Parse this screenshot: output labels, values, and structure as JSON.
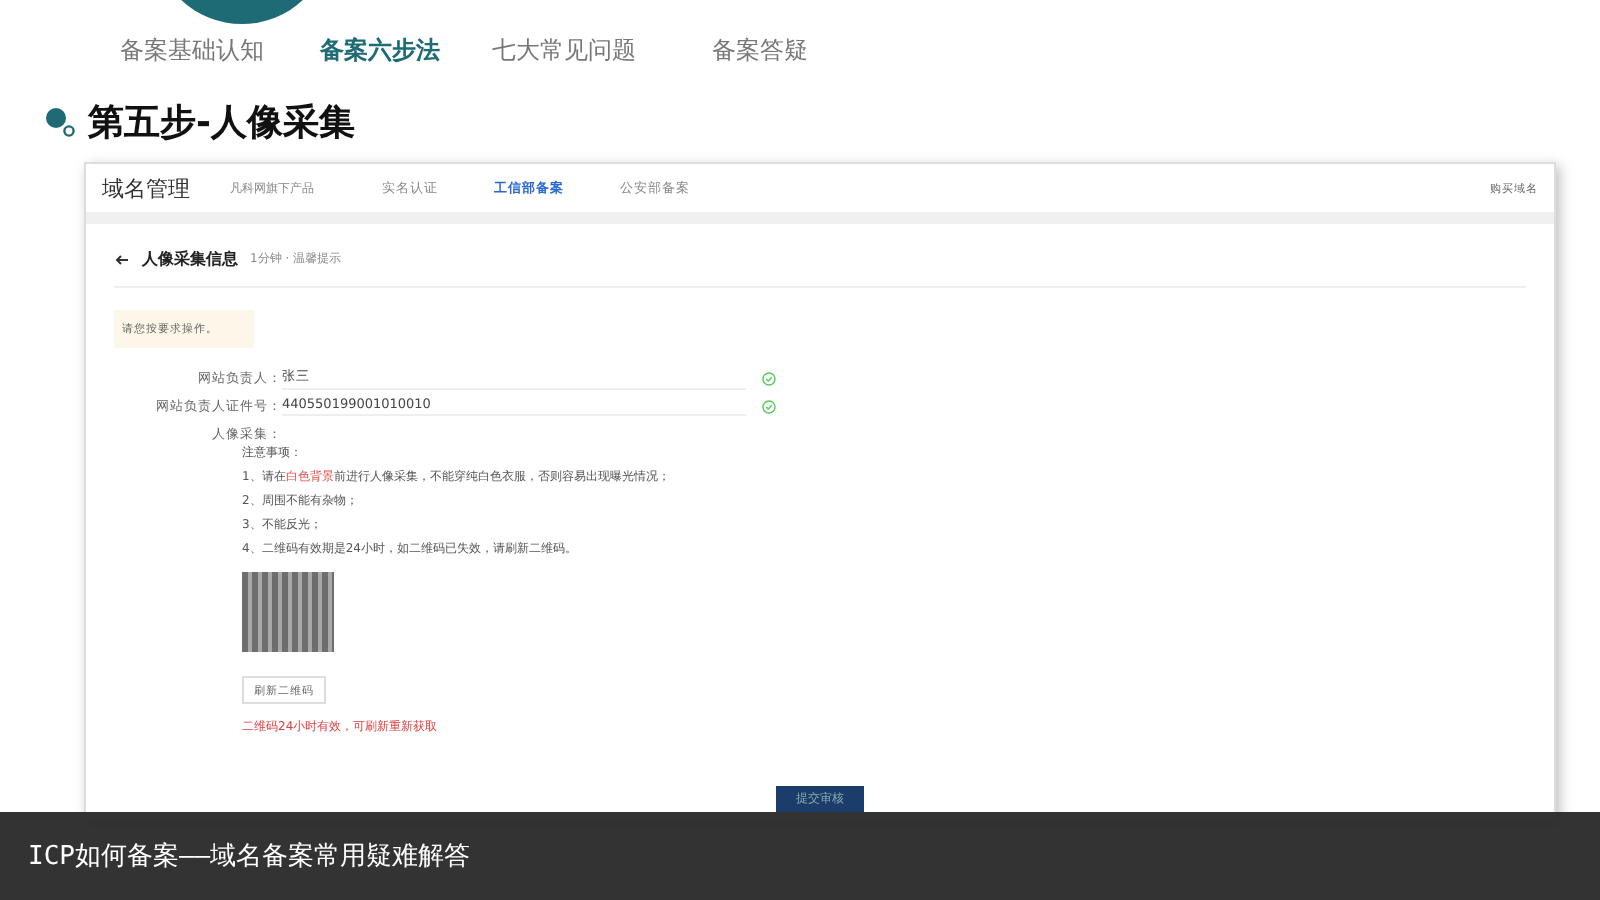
{
  "nav": {
    "tabs": [
      {
        "label": "备案基础认知",
        "selected": false
      },
      {
        "label": "备案六步法",
        "selected": true
      },
      {
        "label": "七大常见问题",
        "selected": false
      },
      {
        "label": "备案答疑",
        "selected": false
      }
    ]
  },
  "heading": "第五步-人像采集",
  "screenshot": {
    "logo": "域名管理",
    "product": "凡科网旗下产品",
    "menu": [
      {
        "label": "实名认证",
        "selected": false
      },
      {
        "label": "工信部备案",
        "selected": true
      },
      {
        "label": "公安部备案",
        "selected": false
      }
    ],
    "account": "购买域名",
    "page_title": "人像采集信息",
    "page_hint": "1分钟 · 温馨提示",
    "notice": "请您按要求操作。",
    "fields": [
      {
        "label": "网站负责人：",
        "value": "张三",
        "valid": true
      },
      {
        "label": "网站负责人证件号：",
        "value": "440550199001010010",
        "valid": true
      }
    ],
    "capture_label": "人像采集：",
    "notes_title": "注意事项：",
    "notes": [
      [
        {
          "text": "1、请在",
          "highlight": false
        },
        {
          "text": "白色背景",
          "highlight": true
        },
        {
          "text": "前进行人像采集，不能穿纯白色衣服，否则容易出现曝光情况；",
          "highlight": false
        }
      ],
      [
        {
          "text": "2、周围不能有杂物；",
          "highlight": false
        }
      ],
      [
        {
          "text": "3、不能反光；",
          "highlight": false
        }
      ],
      [
        {
          "text": "4、二维码有效期是24小时，如二维码已失效，请刷新二维码。",
          "highlight": false
        }
      ]
    ],
    "refresh_button": "刷新二维码",
    "warning": "二维码24小时有效，可刷新重新获取",
    "submit_button": "提交审核"
  },
  "caption": "ICP如何备案——域名备案常用疑难解答"
}
